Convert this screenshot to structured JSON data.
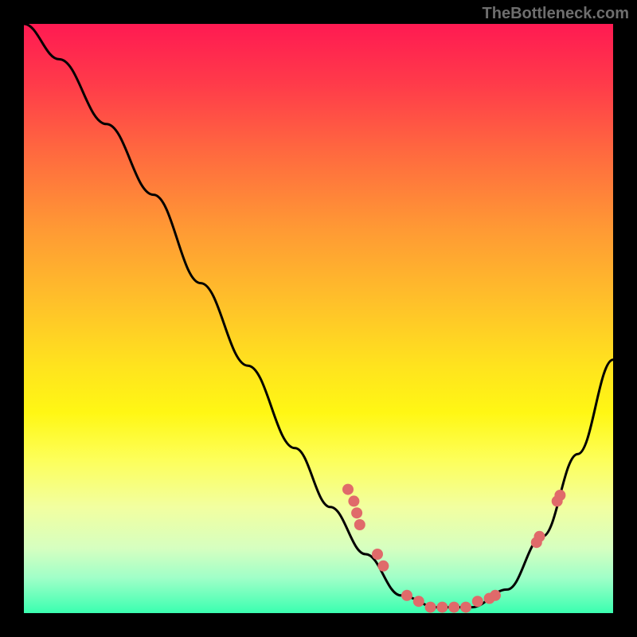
{
  "watermark": "TheBottleneck.com",
  "chart_data": {
    "type": "line",
    "title": "",
    "xlabel": "",
    "ylabel": "",
    "ylim": [
      0,
      100
    ],
    "xlim": [
      0,
      100
    ],
    "curve": {
      "description": "V-shaped bottleneck curve descending from top-left to a flat trough around x=64-80, then rising toward the right",
      "points": [
        {
          "x": 0,
          "y": 100
        },
        {
          "x": 6,
          "y": 94
        },
        {
          "x": 14,
          "y": 83
        },
        {
          "x": 22,
          "y": 71
        },
        {
          "x": 30,
          "y": 56
        },
        {
          "x": 38,
          "y": 42
        },
        {
          "x": 46,
          "y": 28
        },
        {
          "x": 52,
          "y": 18
        },
        {
          "x": 58,
          "y": 10
        },
        {
          "x": 64,
          "y": 3
        },
        {
          "x": 70,
          "y": 1
        },
        {
          "x": 76,
          "y": 1
        },
        {
          "x": 82,
          "y": 4
        },
        {
          "x": 88,
          "y": 13
        },
        {
          "x": 94,
          "y": 27
        },
        {
          "x": 100,
          "y": 43
        }
      ]
    },
    "data_points": [
      {
        "x": 55,
        "y": 21
      },
      {
        "x": 56,
        "y": 19
      },
      {
        "x": 56.5,
        "y": 17
      },
      {
        "x": 57,
        "y": 15
      },
      {
        "x": 60,
        "y": 10
      },
      {
        "x": 61,
        "y": 8
      },
      {
        "x": 65,
        "y": 3
      },
      {
        "x": 67,
        "y": 2
      },
      {
        "x": 69,
        "y": 1
      },
      {
        "x": 71,
        "y": 1
      },
      {
        "x": 73,
        "y": 1
      },
      {
        "x": 75,
        "y": 1
      },
      {
        "x": 77,
        "y": 2
      },
      {
        "x": 79,
        "y": 2.5
      },
      {
        "x": 80,
        "y": 3
      },
      {
        "x": 87,
        "y": 12
      },
      {
        "x": 87.5,
        "y": 13
      },
      {
        "x": 90.5,
        "y": 19
      },
      {
        "x": 91,
        "y": 20
      }
    ]
  }
}
